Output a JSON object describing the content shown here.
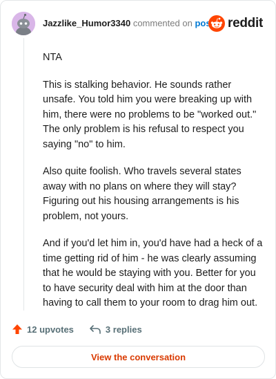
{
  "header": {
    "username": "Jazzlike_Humor3340",
    "commented_text": "commented on",
    "post_link": "post",
    "brand": "reddit"
  },
  "comment": {
    "paragraphs": [
      "NTA",
      "This is stalking behavior. He sounds rather unsafe. You told him you were breaking up with him, there were no problems to be \"worked out.\" The only problem is his refusal to respect you saying \"no\" to him.",
      "Also quite foolish. Who travels several states away with no plans on where they will stay? Figuring out his housing arrangements is his problem, not yours.",
      "And if you'd let him in, you'd have had a heck of a time getting rid of him - he was clearly assuming that he would be staying with you. Better for you to have security deal with him at the door than having to call them to your room to drag him out."
    ]
  },
  "actions": {
    "upvotes": "12 upvotes",
    "replies": "3 replies"
  },
  "footer": {
    "button_label": "View the conversation"
  },
  "colors": {
    "accent": "#ff4500",
    "link": "#0079d3",
    "button_text": "#d93a00",
    "avatar_bg": "#d9b6e8"
  },
  "icons": [
    "avatar-icon",
    "reddit-logo-icon",
    "upvote-arrow-icon",
    "reply-arrow-icon"
  ]
}
